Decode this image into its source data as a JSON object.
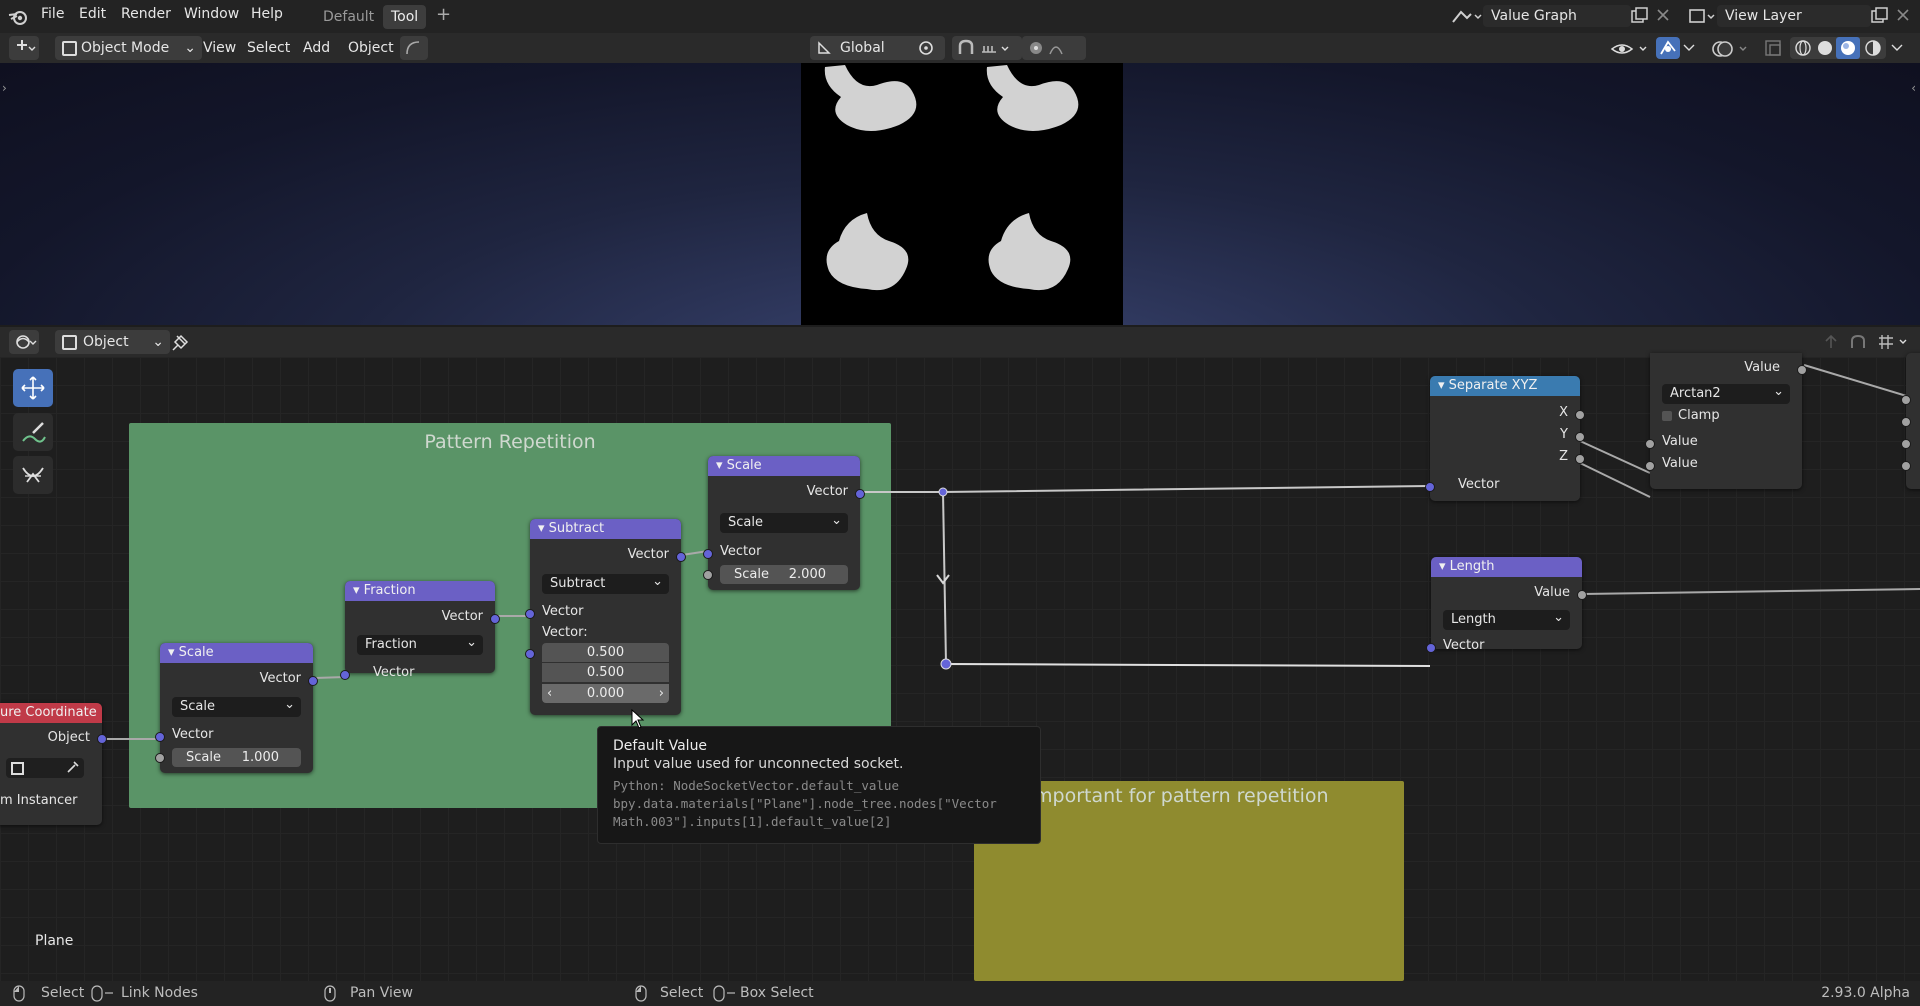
{
  "menu": {
    "file": "File",
    "edit": "Edit",
    "render": "Render",
    "window": "Window",
    "help": "Help"
  },
  "workspaces": {
    "default": "Default",
    "tool": "Tool",
    "add": "+"
  },
  "scene": {
    "name": "Value Graph",
    "view_layer": "View Layer"
  },
  "viewport_header": {
    "mode": "Object Mode",
    "view": "View",
    "select": "Select",
    "add": "Add",
    "object": "Object",
    "orientation": "Global"
  },
  "node_header": {
    "type": "Object"
  },
  "frames": {
    "pattern": "Pattern Repetition",
    "important": "mportant for pattern repetition"
  },
  "nodes": {
    "tex_coord": {
      "title": "ure Coordinate",
      "out_object": "Object",
      "instancer": "m Instancer"
    },
    "scale1": {
      "title": "Scale",
      "out_vector": "Vector",
      "op": "Scale",
      "in_vector": "Vector",
      "scale_label": "Scale",
      "scale_value": "1.000"
    },
    "fraction": {
      "title": "Fraction",
      "out_vector": "Vector",
      "op": "Fraction",
      "in_vector": "Vector"
    },
    "subtract": {
      "title": "Subtract",
      "out_vector": "Vector",
      "op": "Subtract",
      "in_vector": "Vector",
      "vec_label": "Vector:",
      "x": "0.500",
      "y": "0.500",
      "z": "0.000"
    },
    "scale2": {
      "title": "Scale",
      "out_vector": "Vector",
      "op": "Scale",
      "in_vector": "Vector",
      "scale_label": "Scale",
      "scale_value": "2.000"
    },
    "separate": {
      "title": "Separate XYZ",
      "x": "X",
      "y": "Y",
      "z": "Z",
      "in_vector": "Vector"
    },
    "arctan": {
      "out_value": "Value",
      "op": "Arctan2",
      "clamp": "Clamp",
      "in1": "Value",
      "in2": "Value"
    },
    "length": {
      "title": "Length",
      "out_value": "Value",
      "op": "Length",
      "in_vector": "Vector"
    }
  },
  "tooltip": {
    "title": "Default Value",
    "desc": "Input value used for unconnected socket.",
    "py1": "Python: NodeSocketVector.default_value",
    "py2": "bpy.data.materials[\"Plane\"].node_tree.nodes[\"Vector",
    "py3": "Math.003\"].inputs[1].default_value[2]"
  },
  "object_name": "Plane",
  "status": {
    "select1": "Select",
    "link": "Link Nodes",
    "pan": "Pan View",
    "select2": "Select",
    "box": "Box Select",
    "version": "2.93.0 Alpha"
  },
  "colors": {
    "vector_header": "#6b60c5",
    "converter_header": "#3a7bb0",
    "input_header": "#c03a48",
    "frame_green": "#5a9467",
    "frame_yellow": "#8f8b2f",
    "active_tool": "#4671b9"
  },
  "icons": [
    "blender-logo-icon",
    "editor-type-icon",
    "cursor-select-icon",
    "annotate-icon",
    "cut-links-icon",
    "pin-icon",
    "mouse-icon"
  ]
}
